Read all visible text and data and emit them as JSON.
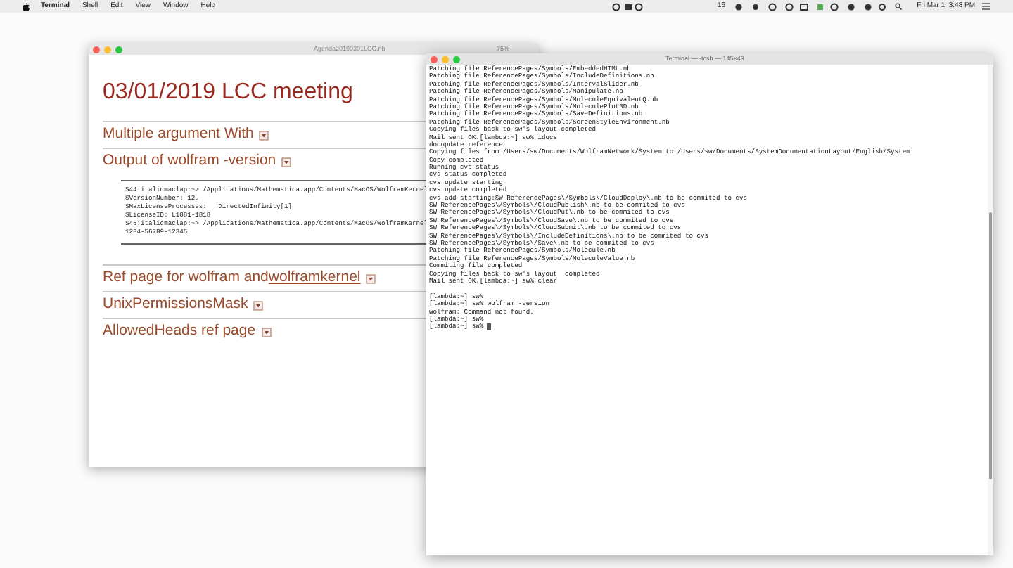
{
  "menu_bar": {
    "menus": [
      "Terminal",
      "Shell",
      "Edit",
      "View",
      "Window",
      "Help"
    ],
    "status_count": "16",
    "clock": "Fri Mar 1  3:48 PM"
  },
  "notebook": {
    "title": "Agenda20190301LCC.nb",
    "zoom": "75%",
    "heading": "03/01/2019 LCC meeting",
    "sections": [
      {
        "title": "Multiple argument With"
      },
      {
        "title": "Output of wolfram -version",
        "output_lines": [
          "S44:italicmaclap:~> /Applications/Mathematica.app/Contents/MacOS/WolframKernel",
          "$VersionNumber: 12.",
          "$MaxLicenseProcesses:   DirectedInfinity[1]",
          "$LicenseID: L1081-1818",
          "S45:italicmaclap:~> /Applications/Mathematica.app/Contents/MacOS/WolframKernel",
          "1234-56789-12345"
        ]
      },
      {
        "title": "Ref page for wolfram and ",
        "link": "wolframkernel"
      },
      {
        "title": "UnixPermissionsMask"
      },
      {
        "title": "AllowedHeads ref page"
      }
    ]
  },
  "terminal": {
    "title": "Terminal — -tcsh — 145×49",
    "lines": [
      "Patching file ReferencePages/Symbols/EmbeddedHTML.nb",
      "Patching file ReferencePages/Symbols/IncludeDefinitions.nb",
      "Patching file ReferencePages/Symbols/IntervalSlider.nb",
      "Patching file ReferencePages/Symbols/Manipulate.nb",
      "Patching file ReferencePages/Symbols/MoleculeEquivalentQ.nb",
      "Patching file ReferencePages/Symbols/MoleculePlot3D.nb",
      "Patching file ReferencePages/Symbols/SaveDefinitions.nb",
      "Patching file ReferencePages/Symbols/ScreenStyleEnvironment.nb",
      "Copying files back to sw's layout completed",
      "Mail sent OK.[lambda:~] sw% idocs",
      "docupdate reference",
      "Copying files from /Users/sw/Documents/WolframNetwork/System to /Users/sw/Documents/SystemDocumentationLayout/English/System",
      "Copy completed",
      "Running cvs status",
      "cvs status completed",
      "cvs update starting",
      "cvs update completed",
      "cvs add starting:SW ReferencePages\\/Symbols\\/CloudDeploy\\.nb to be commited to cvs",
      "SW ReferencePages\\/Symbols\\/CloudPublish\\.nb to be commited to cvs",
      "SW ReferencePages\\/Symbols\\/CloudPut\\.nb to be commited to cvs",
      "SW ReferencePages\\/Symbols\\/CloudSave\\.nb to be commited to cvs",
      "SW ReferencePages\\/Symbols\\/CloudSubmit\\.nb to be commited to cvs",
      "SW ReferencePages\\/Symbols\\/IncludeDefinitions\\.nb to be commited to cvs",
      "SW ReferencePages\\/Symbols\\/Save\\.nb to be commited to cvs",
      "Patching file ReferencePages/Symbols/Molecule.nb",
      "Patching file ReferencePages/Symbols/MoleculeValue.nb",
      "Commiting file completed",
      "Copying files back to sw's layout  completed",
      "Mail sent OK.[lambda:~] sw% clear"
    ],
    "prompt_lines": [
      "[lambda:~] sw%",
      "[lambda:~] sw% wolfram -version",
      "wolfram: Command not found.",
      "[lambda:~] sw%",
      "[lambda:~] sw%"
    ]
  }
}
